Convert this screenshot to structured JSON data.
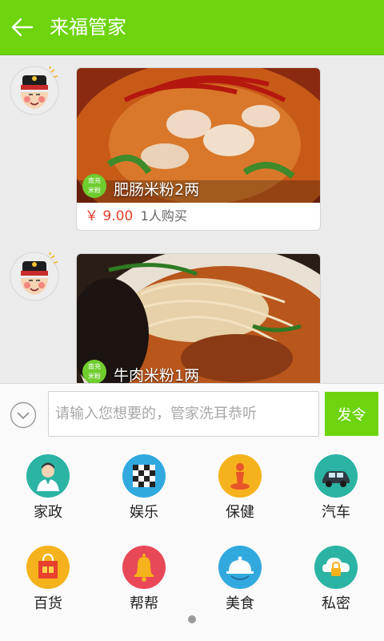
{
  "header": {
    "title": "来福管家"
  },
  "messages": [
    {
      "shop_badge_line1": "南充",
      "shop_badge_line2": "米粉",
      "dish_name": "肥肠米粉2两",
      "price": "￥ 9.00",
      "sold": "1人购买"
    },
    {
      "shop_badge_line1": "南充",
      "shop_badge_line2": "米粉",
      "dish_name": "牛肉米粉1两"
    }
  ],
  "input": {
    "placeholder": "请输入您想要的，管家洗耳恭听",
    "value": "",
    "send_label": "发令"
  },
  "categories": [
    {
      "label": "家政",
      "icon": "housekeeper-icon",
      "color": "#2bb3a3"
    },
    {
      "label": "娱乐",
      "icon": "checkerboard-icon",
      "color": "#31a9df"
    },
    {
      "label": "保健",
      "icon": "massage-icon",
      "color": "#f5b21c"
    },
    {
      "label": "汽车",
      "icon": "car-icon",
      "color": "#2bb3a3"
    },
    {
      "label": "百货",
      "icon": "shopping-bag-icon",
      "color": "#f5b21c"
    },
    {
      "label": "帮帮",
      "icon": "bell-icon",
      "color": "#e84858"
    },
    {
      "label": "美食",
      "icon": "food-cloche-icon",
      "color": "#31a9df"
    },
    {
      "label": "私密",
      "icon": "cloud-lock-icon",
      "color": "#2bb3a3"
    }
  ],
  "colors": {
    "accent": "#6dd40d",
    "price": "#e8412f"
  }
}
